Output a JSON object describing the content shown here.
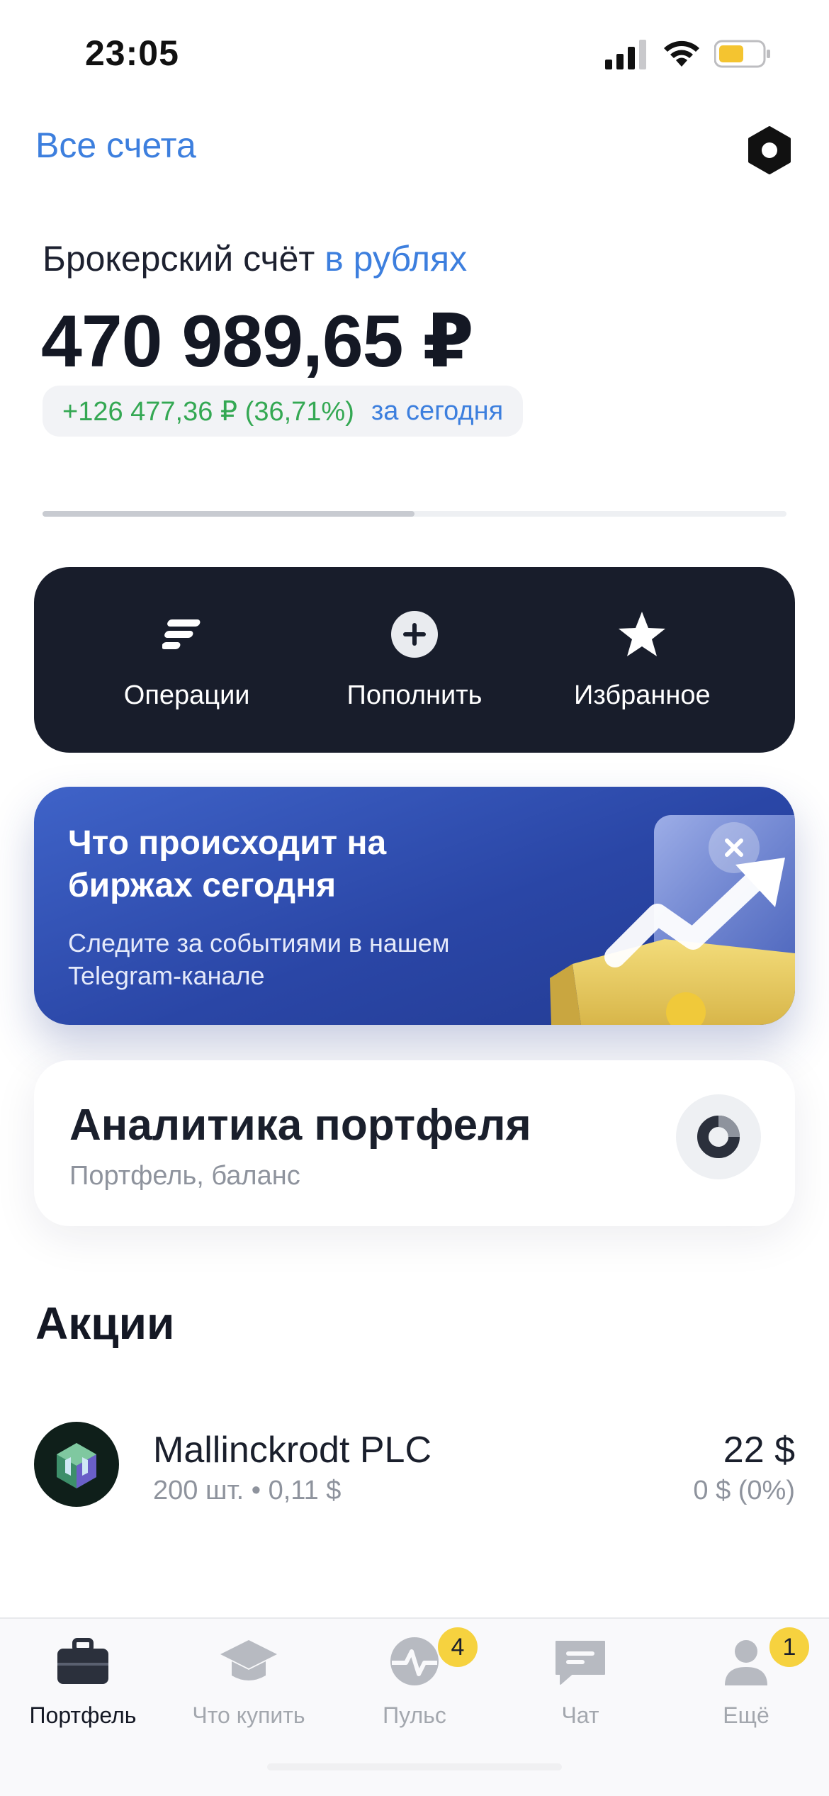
{
  "status_bar": {
    "time": "23:05"
  },
  "header": {
    "all_accounts": "Все счета"
  },
  "account": {
    "label": "Брокерский счёт",
    "currency_link": "в рублях",
    "balance": "470 989,65 ₽",
    "change": "+126 477,36 ₽ (36,71%)",
    "period": "за сегодня",
    "progress": 0.5
  },
  "actions": [
    {
      "label": "Операции",
      "icon": "operations-icon"
    },
    {
      "label": "Пополнить",
      "icon": "plus-circle-icon"
    },
    {
      "label": "Избранное",
      "icon": "star-icon"
    }
  ],
  "promo": {
    "title": "Что происходит на биржах сегодня",
    "subtitle": "Следите за событиями в нашем Telegram-канале"
  },
  "analytics": {
    "title": "Аналитика портфеля",
    "subtitle": "Портфель, баланс"
  },
  "stocks": {
    "section_title": "Акции",
    "items": [
      {
        "name": "Mallinckrodt PLC",
        "meta": "200 шт. • 0,11 $",
        "value": "22 $",
        "change": "0 $ (0%)"
      }
    ]
  },
  "tabbar": {
    "items": [
      {
        "label": "Портфель",
        "icon": "briefcase-icon",
        "active": true,
        "badge": ""
      },
      {
        "label": "Что купить",
        "icon": "graduation-cap-icon",
        "active": false,
        "badge": ""
      },
      {
        "label": "Пульс",
        "icon": "pulse-icon",
        "active": false,
        "badge": "4"
      },
      {
        "label": "Чат",
        "icon": "chat-icon",
        "active": false,
        "badge": ""
      },
      {
        "label": "Ещё",
        "icon": "profile-icon",
        "active": false,
        "badge": "1"
      }
    ]
  },
  "colors": {
    "accent": "#3d7fde",
    "gain": "#34a853",
    "dark_panel": "#181d2b",
    "badge": "#f6d23f"
  }
}
